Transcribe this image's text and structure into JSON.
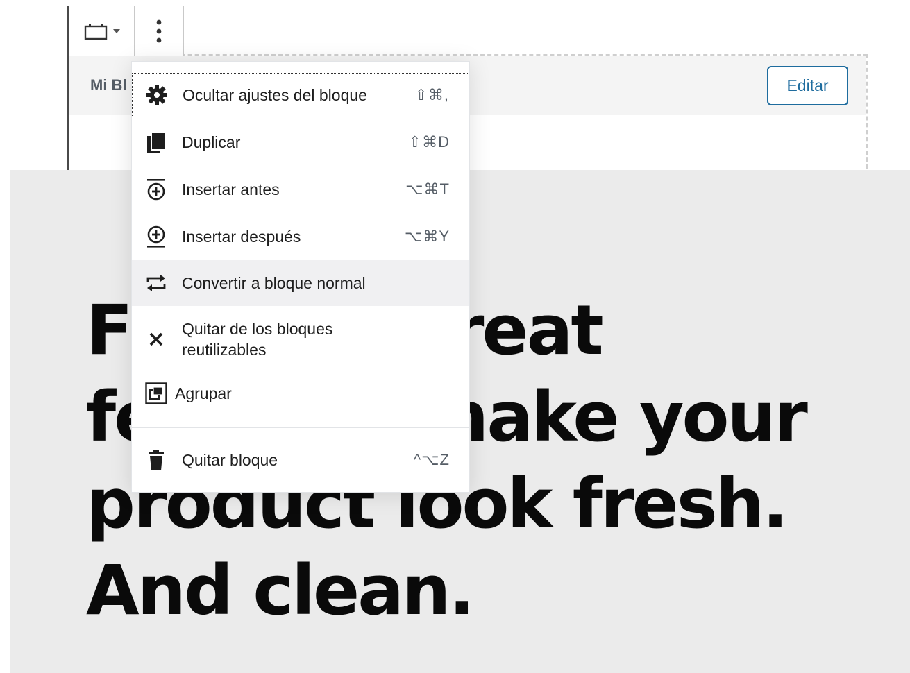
{
  "block": {
    "title": "Mi Bl",
    "edit_label": "Editar"
  },
  "heading": {
    "text": "Fun and great features make your product look fresh. And clean."
  },
  "menu": {
    "items": [
      {
        "label": "Ocultar ajustes del bloque",
        "shortcut": "⇧⌘,",
        "icon": "gear-icon"
      },
      {
        "label": "Duplicar",
        "shortcut": "⇧⌘D",
        "icon": "duplicate-icon"
      },
      {
        "label": "Insertar antes",
        "shortcut": "⌥⌘T",
        "icon": "insert-before-icon"
      },
      {
        "label": "Insertar después",
        "shortcut": "⌥⌘Y",
        "icon": "insert-after-icon"
      },
      {
        "label": "Convertir a bloque normal",
        "shortcut": "",
        "icon": "convert-icon"
      },
      {
        "label": "Quitar de los bloques reutilizables",
        "shortcut": "",
        "icon": "close-icon"
      },
      {
        "label": "Agrupar",
        "shortcut": "",
        "icon": "group-icon"
      },
      {
        "label": "Quitar bloque",
        "shortcut": "^⌥Z",
        "icon": "trash-icon"
      }
    ]
  },
  "colors": {
    "accent": "#1e6c9e",
    "content_bg": "#ebebeb"
  }
}
